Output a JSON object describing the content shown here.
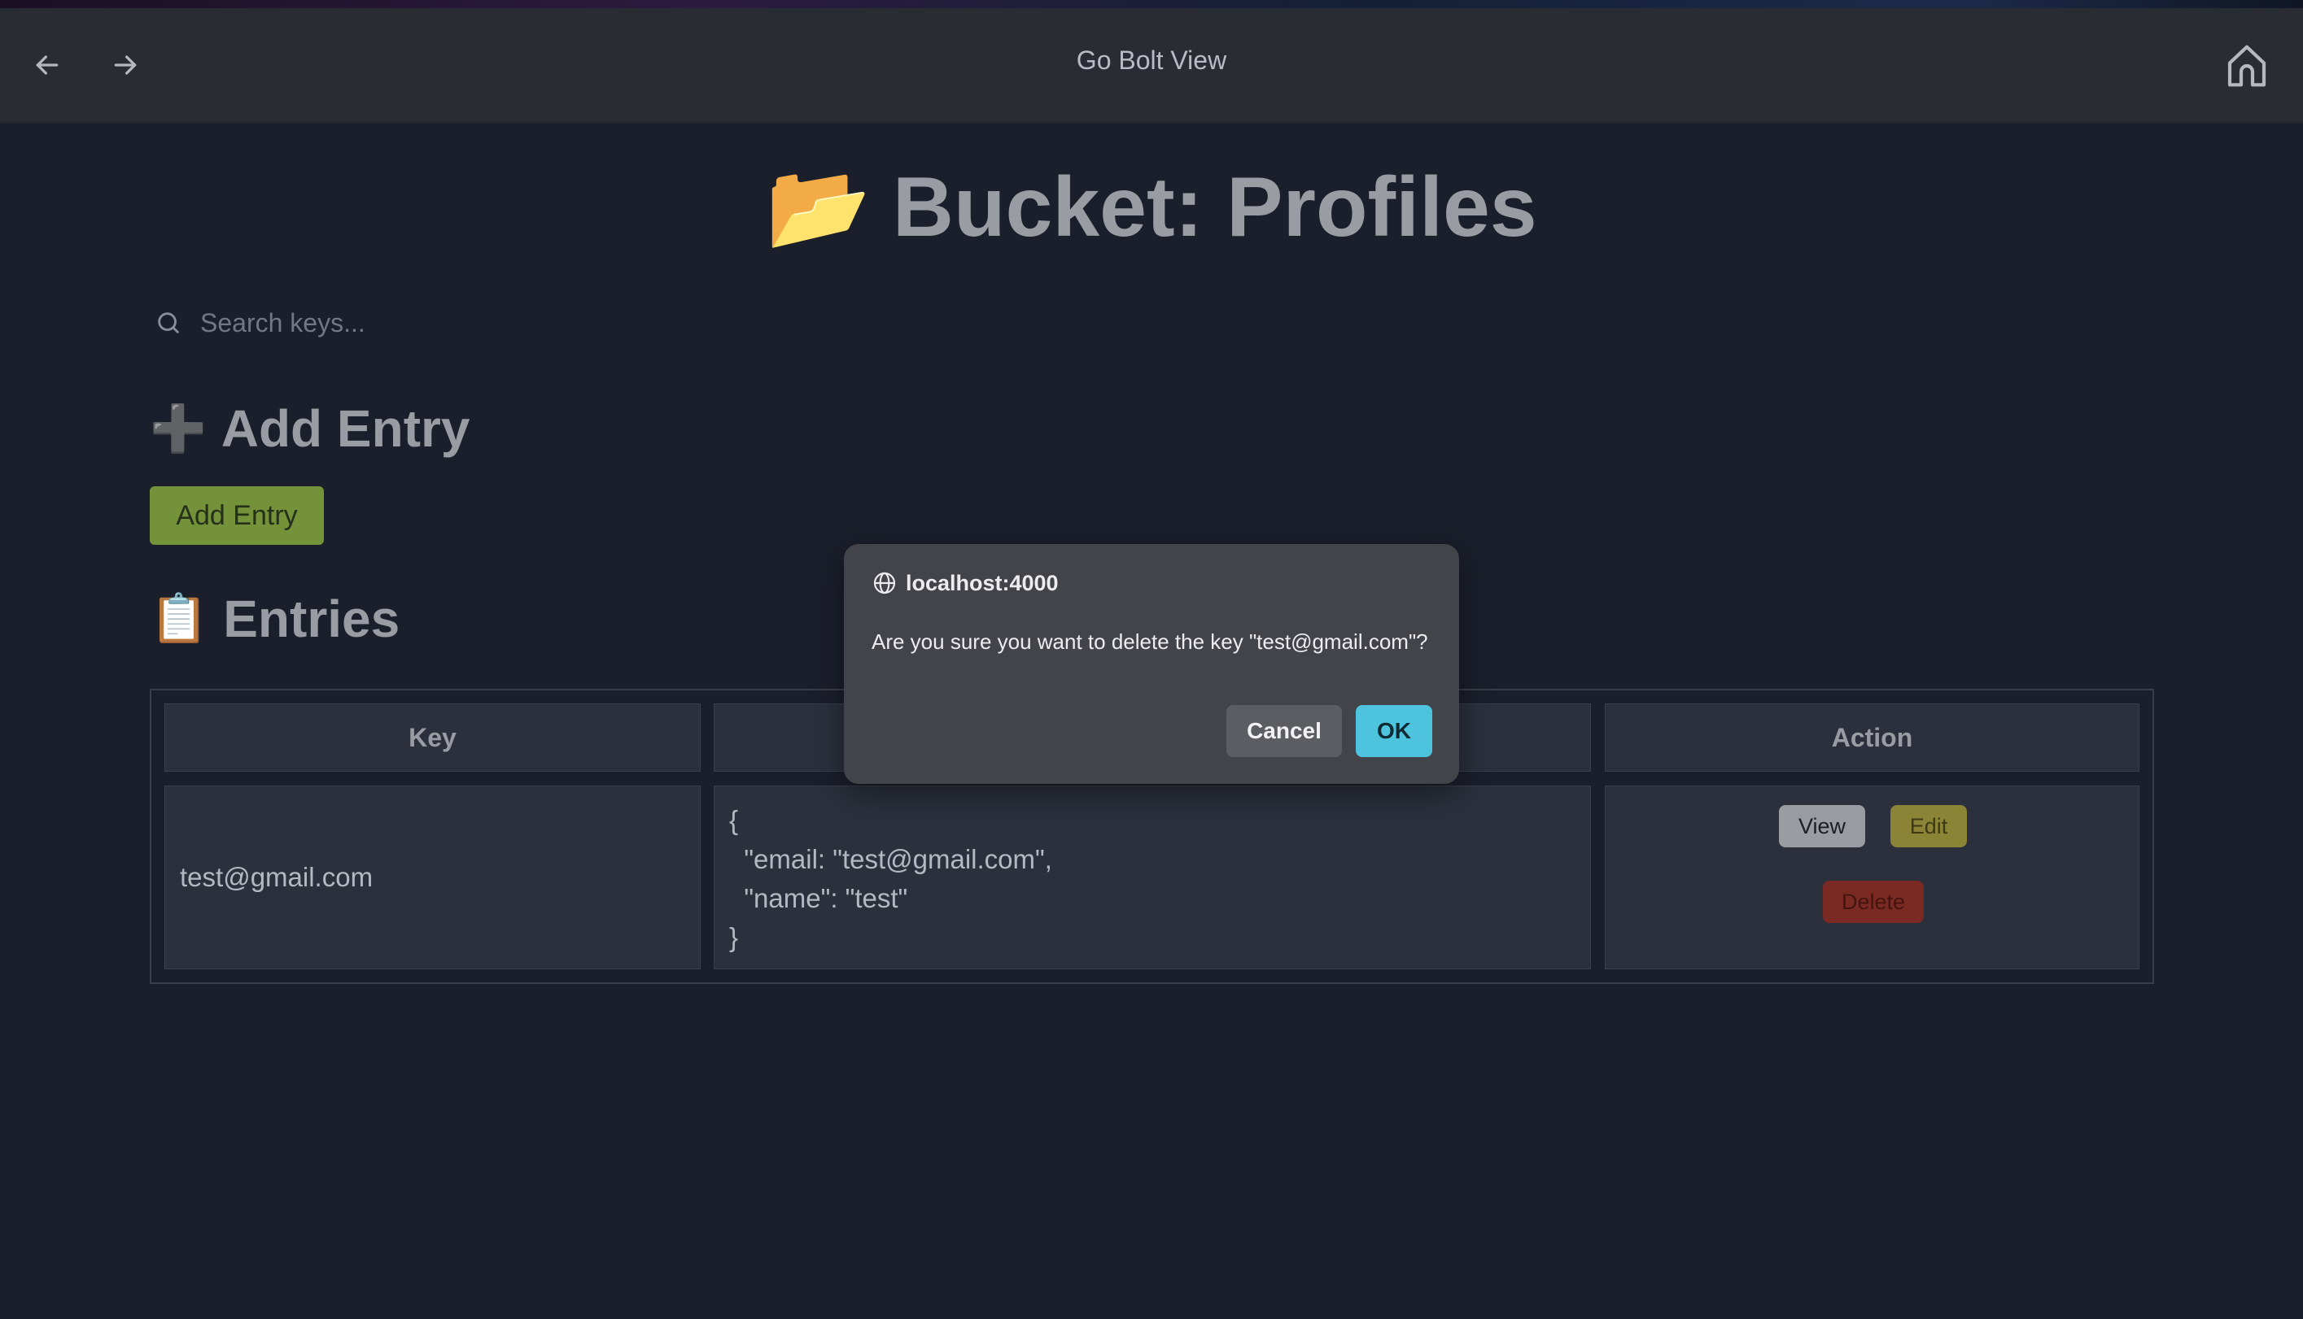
{
  "window": {
    "title": "Go Bolt View"
  },
  "nav": {
    "back_icon": "arrow-left-icon",
    "forward_icon": "arrow-right-icon",
    "home_icon": "home-icon"
  },
  "page": {
    "title_emoji": "📂",
    "title": "Bucket: Profiles"
  },
  "search": {
    "placeholder": "Search keys...",
    "value": ""
  },
  "add_section": {
    "emoji": "➕",
    "heading": "Add Entry",
    "button_label": "Add Entry"
  },
  "entries_section": {
    "emoji": "📋",
    "heading": "Entries"
  },
  "table": {
    "headers": {
      "key": "Key",
      "value": "Value",
      "action": "Action"
    },
    "rows": [
      {
        "key": "test@gmail.com",
        "value": "{\n  \"email: \"test@gmail.com\",\n  \"name\": \"test\"\n}",
        "actions": {
          "view": "View",
          "edit": "Edit",
          "delete": "Delete"
        }
      }
    ]
  },
  "dialog": {
    "origin": "localhost:4000",
    "message": "Are you sure you want to delete the key \"test@gmail.com\"?",
    "cancel_label": "Cancel",
    "ok_label": "OK"
  },
  "colors": {
    "background": "#1b1f2b",
    "add_button": "#74923a",
    "view_button": "#9a9ca2",
    "edit_button": "#8b8336",
    "delete_button": "#7a2a22",
    "ok_button": "#4ec3de"
  }
}
